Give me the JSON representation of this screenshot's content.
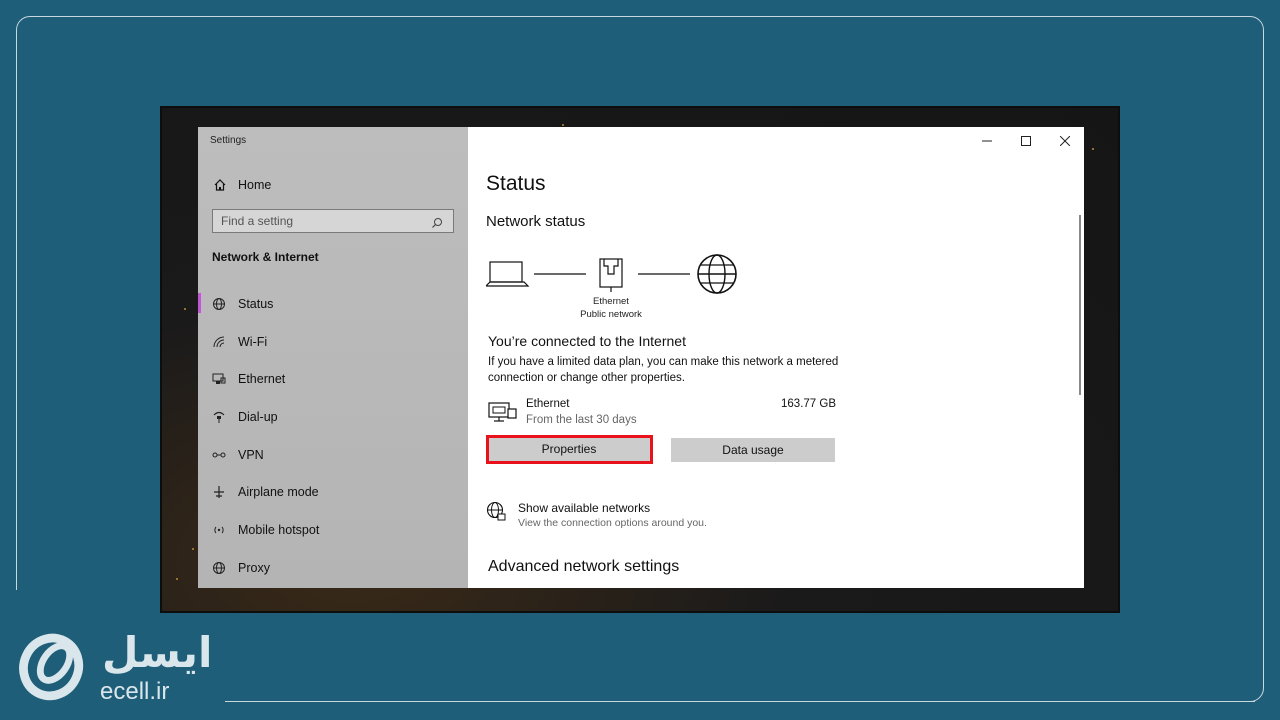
{
  "brand": {
    "name_fa": "ایسل",
    "domain": "ecell.ir"
  },
  "window": {
    "app_title": "Settings",
    "controls": [
      "minimize-icon",
      "maximize-icon",
      "close-icon"
    ]
  },
  "sidebar": {
    "home_label": "Home",
    "search_placeholder": "Find a setting",
    "section_title": "Network & Internet",
    "items": [
      {
        "label": "Status",
        "icon": "globe-status-icon",
        "active": true
      },
      {
        "label": "Wi-Fi",
        "icon": "wifi-icon",
        "active": false
      },
      {
        "label": "Ethernet",
        "icon": "ethernet-icon",
        "active": false
      },
      {
        "label": "Dial-up",
        "icon": "dialup-icon",
        "active": false
      },
      {
        "label": "VPN",
        "icon": "vpn-icon",
        "active": false
      },
      {
        "label": "Airplane mode",
        "icon": "airplane-icon",
        "active": false
      },
      {
        "label": "Mobile hotspot",
        "icon": "hotspot-icon",
        "active": false
      },
      {
        "label": "Proxy",
        "icon": "proxy-icon",
        "active": false
      }
    ]
  },
  "main": {
    "title": "Status",
    "network_status_title": "Network status",
    "diagram": {
      "adapter_line1": "Ethernet",
      "adapter_line2": "Public network"
    },
    "connected_title": "You’re connected to the Internet",
    "connected_desc": "If you have a limited data plan, you can make this network a metered connection or change other properties.",
    "connection": {
      "name": "Ethernet",
      "period": "From the last 30 days",
      "usage": "163.77 GB"
    },
    "buttons": {
      "properties": "Properties",
      "data_usage": "Data usage"
    },
    "show_networks": {
      "title": "Show available networks",
      "subtitle": "View the connection options around you."
    },
    "advanced_title": "Advanced network settings"
  },
  "colors": {
    "page_bg": "#1f5e78",
    "highlight": "#e8131a",
    "active_indicator": "#c356d6",
    "button_bg": "#cccccc"
  }
}
